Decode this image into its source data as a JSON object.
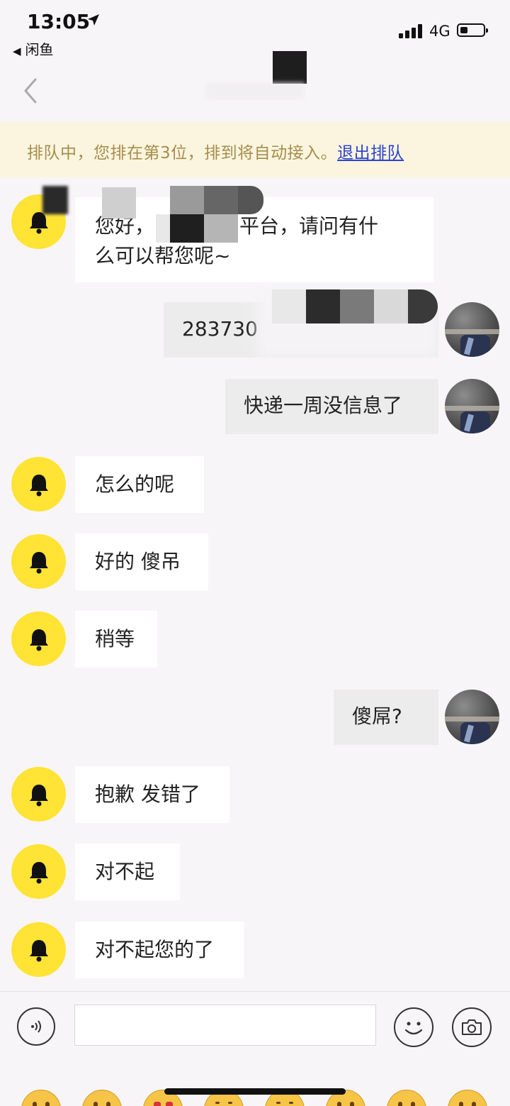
{
  "status": {
    "time": "13:05",
    "back_app": "闲鱼",
    "network": "4G"
  },
  "queue": {
    "text": "排队中，您排在第3位，排到将自动接入。",
    "exit_label": "退出排队"
  },
  "messages": [
    {
      "from": "bot",
      "line1": "您好，",
      "line1b": "平台，请问有什",
      "line2": "么可以帮您呢~"
    },
    {
      "from": "user",
      "text": "283730"
    },
    {
      "from": "user",
      "text": "快递一周没信息了"
    },
    {
      "from": "bot",
      "text": "怎么的呢"
    },
    {
      "from": "bot",
      "text": "好的 傻吊"
    },
    {
      "from": "bot",
      "text": "稍等"
    },
    {
      "from": "user",
      "text": "傻屌?"
    },
    {
      "from": "bot",
      "text": "抱歉 发错了"
    },
    {
      "from": "bot",
      "text": "对不起"
    },
    {
      "from": "bot",
      "text": "对不起您的了"
    }
  ],
  "input": {
    "placeholder": ""
  },
  "icons": {
    "bot_avatar": "bell-icon",
    "voice": "voice-icon",
    "emoji": "smiley-icon",
    "camera": "camera-icon"
  },
  "colors": {
    "bot_avatar_bg": "#ffe335",
    "queue_bg": "#fbf5df",
    "queue_text": "#a58d4c",
    "link": "#2b43cf"
  }
}
